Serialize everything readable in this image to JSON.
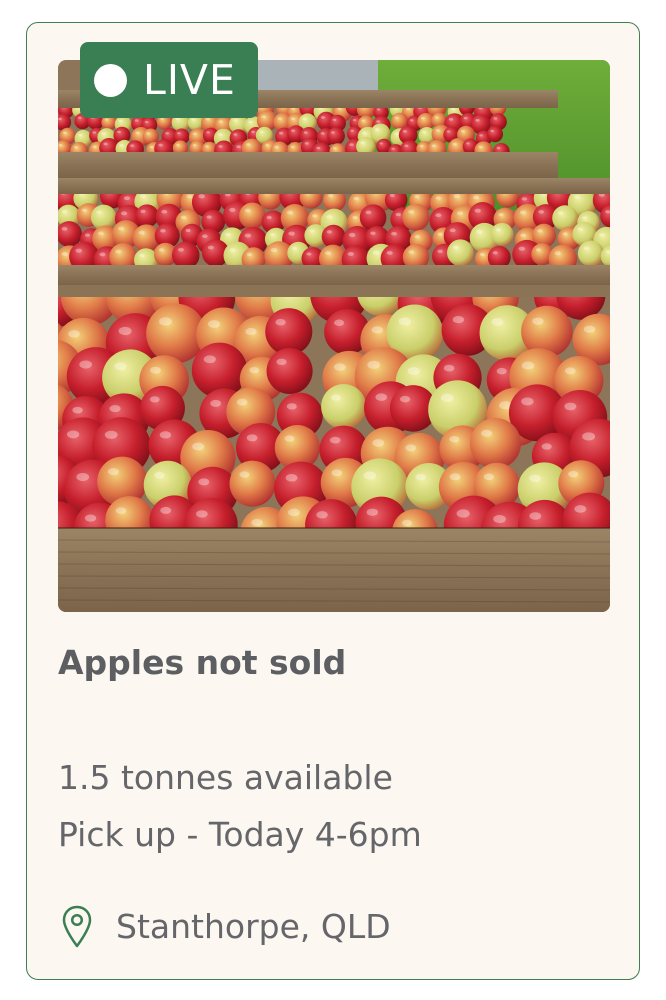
{
  "listing": {
    "badge_label": "LIVE",
    "title": "Apples not sold",
    "quantity": "1.5 tonnes available",
    "pickup": "Pick up - Today 4-6pm",
    "location": "Stanthorpe, QLD",
    "photo_icon": "apples-in-crates-photo",
    "location_icon": "map-pin-icon"
  },
  "colors": {
    "accent_green": "#3a7e53",
    "card_background": "#fdf7f1",
    "text_gray": "#64666a"
  }
}
